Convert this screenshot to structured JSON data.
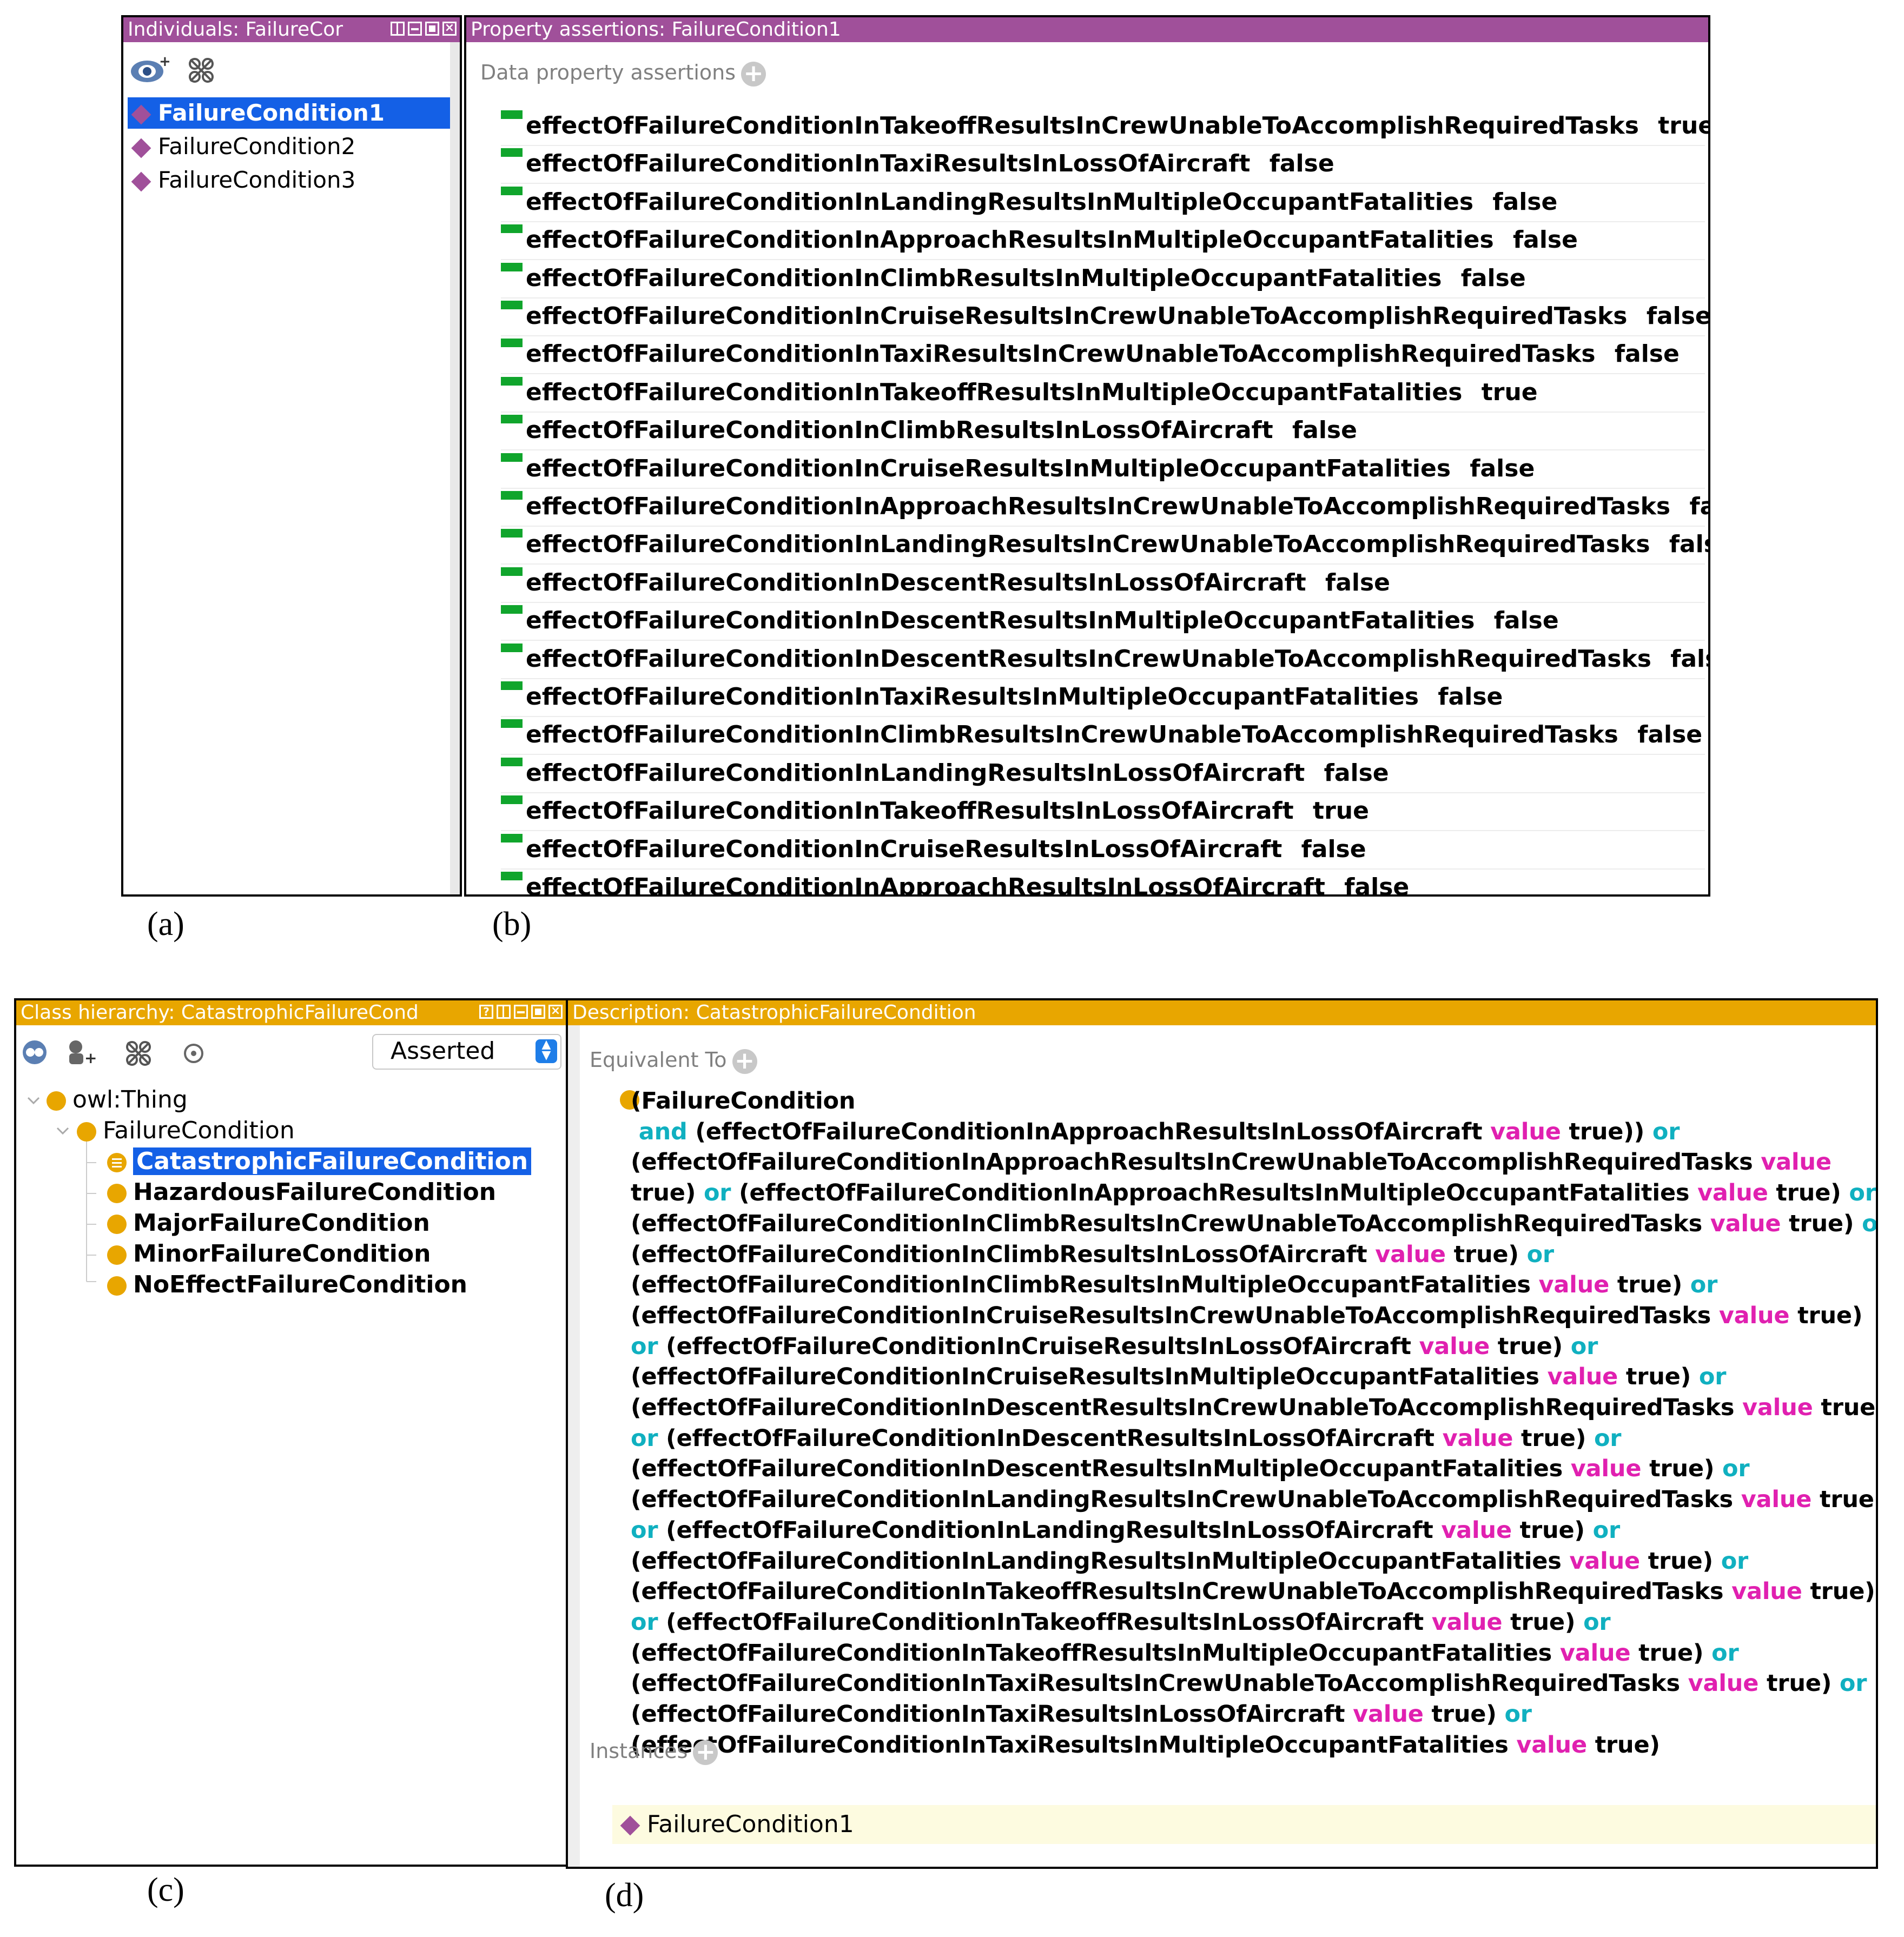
{
  "panel_a": {
    "title": "Individuals: FailureCor",
    "items": [
      "FailureCondition1",
      "FailureCondition2",
      "FailureCondition3"
    ],
    "selected_index": 0,
    "icons": [
      "add-individual-icon",
      "delete-individual-icon"
    ]
  },
  "panel_b": {
    "title": "Property assertions: FailureCondition1",
    "section_label": "Data property assertions",
    "assertions": [
      {
        "property": "effectOfFailureConditionInTakeoffResultsInCrewUnableToAccomplishRequiredTasks",
        "value": "true"
      },
      {
        "property": "effectOfFailureConditionInTaxiResultsInLossOfAircraft",
        "value": "false"
      },
      {
        "property": "effectOfFailureConditionInLandingResultsInMultipleOccupantFatalities",
        "value": "false"
      },
      {
        "property": "effectOfFailureConditionInApproachResultsInMultipleOccupantFatalities",
        "value": "false"
      },
      {
        "property": "effectOfFailureConditionInClimbResultsInMultipleOccupantFatalities",
        "value": "false"
      },
      {
        "property": "effectOfFailureConditionInCruiseResultsInCrewUnableToAccomplishRequiredTasks",
        "value": "false"
      },
      {
        "property": "effectOfFailureConditionInTaxiResultsInCrewUnableToAccomplishRequiredTasks",
        "value": "false"
      },
      {
        "property": "effectOfFailureConditionInTakeoffResultsInMultipleOccupantFatalities",
        "value": "true"
      },
      {
        "property": "effectOfFailureConditionInClimbResultsInLossOfAircraft",
        "value": "false"
      },
      {
        "property": "effectOfFailureConditionInCruiseResultsInMultipleOccupantFatalities",
        "value": "false"
      },
      {
        "property": "effectOfFailureConditionInApproachResultsInCrewUnableToAccomplishRequiredTasks",
        "value": "false"
      },
      {
        "property": "effectOfFailureConditionInLandingResultsInCrewUnableToAccomplishRequiredTasks",
        "value": "false"
      },
      {
        "property": "effectOfFailureConditionInDescentResultsInLossOfAircraft",
        "value": "false"
      },
      {
        "property": "effectOfFailureConditionInDescentResultsInMultipleOccupantFatalities",
        "value": "false"
      },
      {
        "property": "effectOfFailureConditionInDescentResultsInCrewUnableToAccomplishRequiredTasks",
        "value": "false"
      },
      {
        "property": "effectOfFailureConditionInTaxiResultsInMultipleOccupantFatalities",
        "value": "false"
      },
      {
        "property": "effectOfFailureConditionInClimbResultsInCrewUnableToAccomplishRequiredTasks",
        "value": "false"
      },
      {
        "property": "effectOfFailureConditionInLandingResultsInLossOfAircraft",
        "value": "false"
      },
      {
        "property": "effectOfFailureConditionInTakeoffResultsInLossOfAircraft",
        "value": "true"
      },
      {
        "property": "effectOfFailureConditionInCruiseResultsInLossOfAircraft",
        "value": "false"
      },
      {
        "property": "effectOfFailureConditionInApproachResultsInLossOfAircraft",
        "value": "false"
      }
    ]
  },
  "panel_c": {
    "title": "Class hierarchy: CatastrophicFailureCond",
    "select_value": "Asserted",
    "tree": [
      {
        "label": "owl:Thing",
        "level": 0
      },
      {
        "label": "FailureCondition",
        "level": 1
      },
      {
        "label": "CatastrophicFailureCondition",
        "level": 2,
        "selected": true
      },
      {
        "label": "HazardousFailureCondition",
        "level": 2
      },
      {
        "label": "MajorFailureCondition",
        "level": 2
      },
      {
        "label": "MinorFailureCondition",
        "level": 2
      },
      {
        "label": "NoEffectFailureCondition",
        "level": 2
      }
    ]
  },
  "panel_d": {
    "title": "Description: CatastrophicFailureCondition",
    "equivalent_label": "Equivalent To",
    "instances_label": "Instances",
    "instance": "FailureCondition1",
    "keywords": {
      "value": "value",
      "or": "or",
      "and": "and"
    },
    "lines": [
      [
        {
          "t": "(FailureCondition"
        }
      ],
      [
        {
          "t": " "
        },
        {
          "t": "and",
          "k": "and"
        },
        {
          "t": " (effectOfFailureConditionInApproachResultsInLossOfAircraft "
        },
        {
          "t": "value",
          "k": "value"
        },
        {
          "t": " true)) "
        },
        {
          "t": "or",
          "k": "or"
        }
      ],
      [
        {
          "t": "(effectOfFailureConditionInApproachResultsInCrewUnableToAccomplishRequiredTasks "
        },
        {
          "t": "value",
          "k": "value"
        }
      ],
      [
        {
          "t": "true) "
        },
        {
          "t": "or",
          "k": "or"
        },
        {
          "t": " (effectOfFailureConditionInApproachResultsInMultipleOccupantFatalities "
        },
        {
          "t": "value",
          "k": "value"
        },
        {
          "t": " true) "
        },
        {
          "t": "or",
          "k": "or"
        }
      ],
      [
        {
          "t": "(effectOfFailureConditionInClimbResultsInCrewUnableToAccomplishRequiredTasks "
        },
        {
          "t": "value",
          "k": "value"
        },
        {
          "t": " true) "
        },
        {
          "t": "or",
          "k": "or"
        }
      ],
      [
        {
          "t": "(effectOfFailureConditionInClimbResultsInLossOfAircraft "
        },
        {
          "t": "value",
          "k": "value"
        },
        {
          "t": " true) "
        },
        {
          "t": "or",
          "k": "or"
        }
      ],
      [
        {
          "t": "(effectOfFailureConditionInClimbResultsInMultipleOccupantFatalities "
        },
        {
          "t": "value",
          "k": "value"
        },
        {
          "t": " true) "
        },
        {
          "t": "or",
          "k": "or"
        }
      ],
      [
        {
          "t": "(effectOfFailureConditionInCruiseResultsInCrewUnableToAccomplishRequiredTasks "
        },
        {
          "t": "value",
          "k": "value"
        },
        {
          "t": " true)"
        }
      ],
      [
        {
          "t": "or",
          "k": "or"
        },
        {
          "t": " (effectOfFailureConditionInCruiseResultsInLossOfAircraft "
        },
        {
          "t": "value",
          "k": "value"
        },
        {
          "t": " true) "
        },
        {
          "t": "or",
          "k": "or"
        }
      ],
      [
        {
          "t": "(effectOfFailureConditionInCruiseResultsInMultipleOccupantFatalities "
        },
        {
          "t": "value",
          "k": "value"
        },
        {
          "t": " true) "
        },
        {
          "t": "or",
          "k": "or"
        }
      ],
      [
        {
          "t": "(effectOfFailureConditionInDescentResultsInCrewUnableToAccomplishRequiredTasks "
        },
        {
          "t": "value",
          "k": "value"
        },
        {
          "t": " true)"
        }
      ],
      [
        {
          "t": "or",
          "k": "or"
        },
        {
          "t": " (effectOfFailureConditionInDescentResultsInLossOfAircraft "
        },
        {
          "t": "value",
          "k": "value"
        },
        {
          "t": " true) "
        },
        {
          "t": "or",
          "k": "or"
        }
      ],
      [
        {
          "t": "(effectOfFailureConditionInDescentResultsInMultipleOccupantFatalities "
        },
        {
          "t": "value",
          "k": "value"
        },
        {
          "t": " true) "
        },
        {
          "t": "or",
          "k": "or"
        }
      ],
      [
        {
          "t": "(effectOfFailureConditionInLandingResultsInCrewUnableToAccomplishRequiredTasks "
        },
        {
          "t": "value",
          "k": "value"
        },
        {
          "t": " true)"
        }
      ],
      [
        {
          "t": "or",
          "k": "or"
        },
        {
          "t": " (effectOfFailureConditionInLandingResultsInLossOfAircraft "
        },
        {
          "t": "value",
          "k": "value"
        },
        {
          "t": " true) "
        },
        {
          "t": "or",
          "k": "or"
        }
      ],
      [
        {
          "t": "(effectOfFailureConditionInLandingResultsInMultipleOccupantFatalities "
        },
        {
          "t": "value",
          "k": "value"
        },
        {
          "t": " true) "
        },
        {
          "t": "or",
          "k": "or"
        }
      ],
      [
        {
          "t": "(effectOfFailureConditionInTakeoffResultsInCrewUnableToAccomplishRequiredTasks "
        },
        {
          "t": "value",
          "k": "value"
        },
        {
          "t": " true)"
        }
      ],
      [
        {
          "t": "or",
          "k": "or"
        },
        {
          "t": " (effectOfFailureConditionInTakeoffResultsInLossOfAircraft "
        },
        {
          "t": "value",
          "k": "value"
        },
        {
          "t": " true) "
        },
        {
          "t": "or",
          "k": "or"
        }
      ],
      [
        {
          "t": "(effectOfFailureConditionInTakeoffResultsInMultipleOccupantFatalities "
        },
        {
          "t": "value",
          "k": "value"
        },
        {
          "t": " true) "
        },
        {
          "t": "or",
          "k": "or"
        }
      ],
      [
        {
          "t": "(effectOfFailureConditionInTaxiResultsInCrewUnableToAccomplishRequiredTasks "
        },
        {
          "t": "value",
          "k": "value"
        },
        {
          "t": " true) "
        },
        {
          "t": "or",
          "k": "or"
        }
      ],
      [
        {
          "t": "(effectOfFailureConditionInTaxiResultsInLossOfAircraft "
        },
        {
          "t": "value",
          "k": "value"
        },
        {
          "t": " true) "
        },
        {
          "t": "or",
          "k": "or"
        }
      ],
      [
        {
          "t": "(effectOfFailureConditionInTaxiResultsInMultipleOccupantFatalities "
        },
        {
          "t": "value",
          "k": "value"
        },
        {
          "t": " true)"
        }
      ]
    ]
  },
  "captions": {
    "a": "(a)",
    "b": "(b)",
    "c": "(c)",
    "d": "(d)"
  },
  "colors": {
    "purple": "#a0509a",
    "orange": "#e8a600",
    "green": "#10a52c",
    "selection": "#1460e6",
    "keyword_value": "#e020b0",
    "keyword_or": "#10b0c0"
  }
}
